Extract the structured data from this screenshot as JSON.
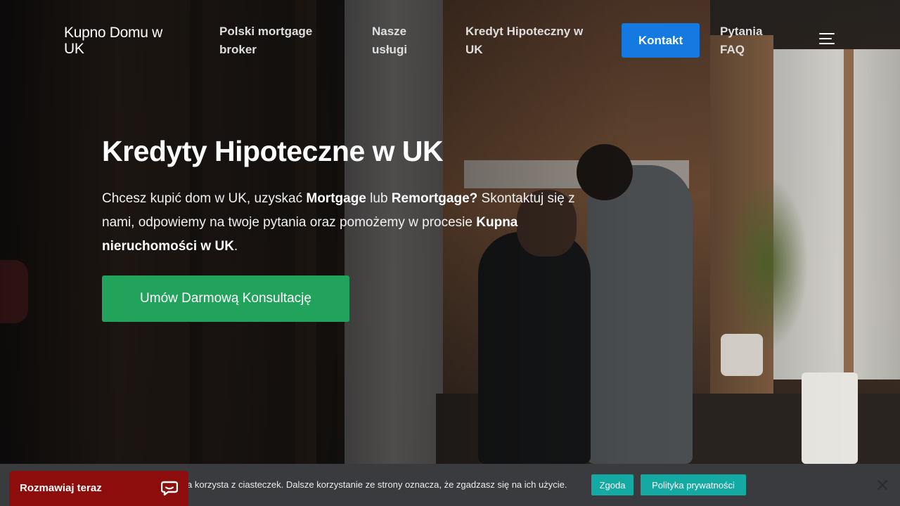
{
  "header": {
    "logo": "Kupno Domu w UK",
    "nav": [
      {
        "label": "Polski mortgage broker"
      },
      {
        "label": "Nasze usługi"
      },
      {
        "label": "Kredyt Hipoteczny w UK"
      },
      {
        "label": "Kontakt"
      },
      {
        "label": "Pytania FAQ"
      }
    ],
    "menu_icon": "hamburger-menu-icon"
  },
  "hero": {
    "title": "Kredyty Hipoteczne w UK",
    "text_parts": {
      "p1": "Chcesz kupić dom w UK, uzyskać ",
      "b1": "Mortgage",
      "p2": " lub ",
      "b2": "Remortgage?",
      "p3": " Skontaktuj się z nami, odpowiemy na twoje pytania oraz pomożemy w procesie ",
      "b3": "Kupna nieruchomości w UK",
      "p4": "."
    },
    "cta_label": "Umów Darmową Konsultację"
  },
  "cookie": {
    "text": "a korzysta z ciasteczek. Dalsze korzystanie ze strony oznacza, że zgadzasz się na ich użycie.",
    "accept_label": "Zgoda",
    "policy_label": "Polityka prywatności",
    "close_icon": "close-icon"
  },
  "chat": {
    "label": "Rozmawiaj teraz",
    "icon": "chat-bubble-icon"
  },
  "colors": {
    "primary_button": "#1479e0",
    "cta_button": "#21a35b",
    "cookie_button": "#14a9a3",
    "chat_widget": "#8d0c0c"
  }
}
